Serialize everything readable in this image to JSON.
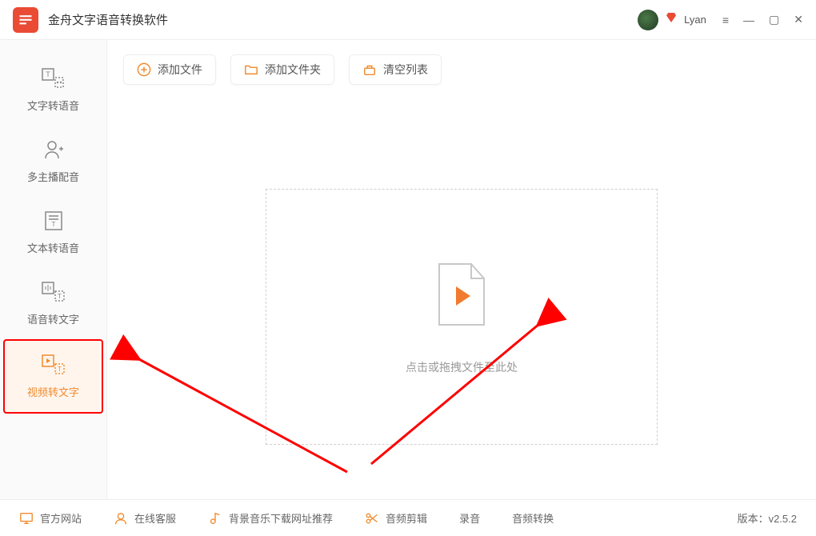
{
  "app": {
    "title": "金舟文字语音转换软件"
  },
  "user": {
    "name": "Lyan"
  },
  "sidebar": [
    {
      "label": "文字转语音"
    },
    {
      "label": "多主播配音"
    },
    {
      "label": "文本转语音"
    },
    {
      "label": "语音转文字"
    },
    {
      "label": "视频转文字"
    }
  ],
  "toolbar": {
    "add_file": "添加文件",
    "add_folder": "添加文件夹",
    "clear_list": "清空列表"
  },
  "dropzone": {
    "text": "点击或拖拽文件至此处"
  },
  "footer": {
    "official_site": "官方网站",
    "online_support": "在线客服",
    "bgm_recommend": "背景音乐下载网址推荐",
    "audio_trim": "音频剪辑",
    "record": "录音",
    "audio_convert": "音频转换",
    "version_label": "版本：",
    "version": "v2.5.2"
  }
}
